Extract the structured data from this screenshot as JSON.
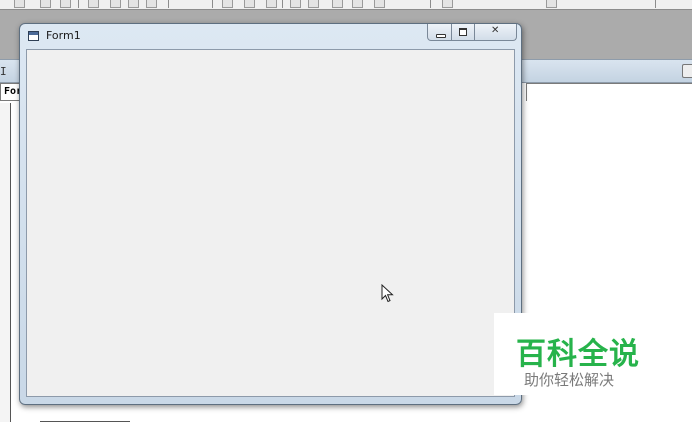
{
  "ide": {
    "code_window": {
      "caption": "I",
      "object_combo_value": "For"
    }
  },
  "form": {
    "title": "Form1",
    "icon": "form-window-icon"
  },
  "caption_buttons": {
    "minimize": "minimize-icon",
    "maximize": "maximize-icon",
    "close": "close-icon"
  },
  "cursor": {
    "icon": "arrow-cursor-icon"
  },
  "watermark": {
    "main_text": "百科全说",
    "sub_text": "助你轻松解决",
    "main_color": "#27b34b",
    "sub_color": "#7a7a7a"
  }
}
